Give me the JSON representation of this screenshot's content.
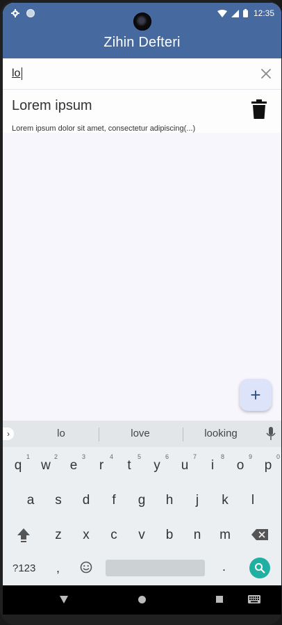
{
  "status": {
    "time": "12:35"
  },
  "app": {
    "title": "Zihin Defteri"
  },
  "search": {
    "value": "lo",
    "placeholder": ""
  },
  "notes": [
    {
      "title": "Lorem ipsum",
      "preview": "Lorem ipsum dolor sit amet, consectetur adipiscing(...)"
    }
  ],
  "fab": {
    "label": "+"
  },
  "keyboard": {
    "suggestions": [
      "lo",
      "love",
      "looking"
    ],
    "row1": [
      "q",
      "w",
      "e",
      "r",
      "t",
      "y",
      "u",
      "i",
      "o",
      "p"
    ],
    "row1_hints": [
      "1",
      "2",
      "3",
      "4",
      "5",
      "6",
      "7",
      "8",
      "9",
      "0"
    ],
    "row2": [
      "a",
      "s",
      "d",
      "f",
      "g",
      "h",
      "j",
      "k",
      "l"
    ],
    "row3": [
      "z",
      "x",
      "c",
      "v",
      "b",
      "n",
      "m"
    ],
    "symbols_label": "?123",
    "comma": ",",
    "period": "."
  }
}
